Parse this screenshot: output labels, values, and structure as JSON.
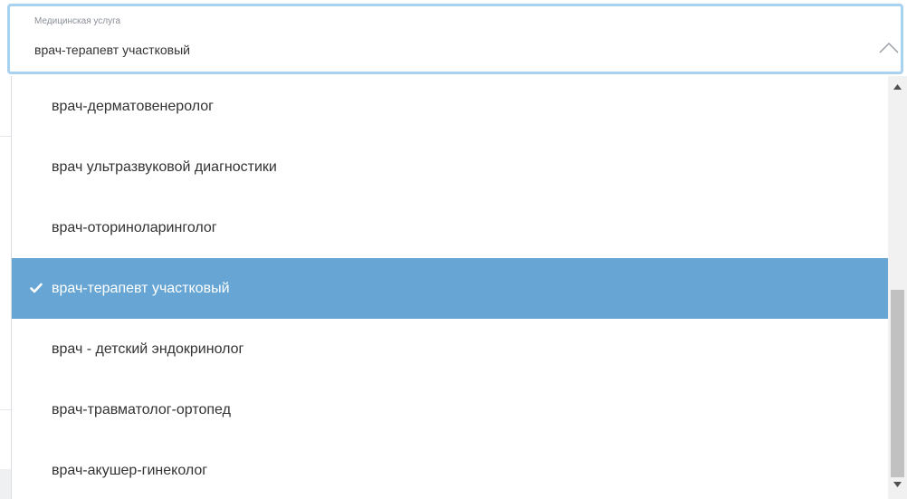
{
  "select": {
    "caption": "Медицинская услуга",
    "value": "врач-терапевт участковый"
  },
  "dropdown": {
    "options": [
      {
        "label": "врач-дерматовенеролог",
        "selected": false
      },
      {
        "label": "врач ультразвуковой диагностики",
        "selected": false
      },
      {
        "label": "врач-оториноларинголог",
        "selected": false
      },
      {
        "label": "врач-терапевт участковый",
        "selected": true
      },
      {
        "label": "врач - детский эндокринолог",
        "selected": false
      },
      {
        "label": "врач-травматолог-ортопед",
        "selected": false
      },
      {
        "label": "врач-акушер-гинеколог",
        "selected": false
      }
    ]
  },
  "colors": {
    "field_border": "#a8d2f0",
    "selected_background": "#67a6d4",
    "text": "#333333"
  },
  "icons": {
    "field_toggle": "chevron-up-icon",
    "selected_marker": "check-icon",
    "scroll_up": "scroll-up-arrow-icon",
    "scroll_down": "scroll-down-arrow-icon"
  }
}
